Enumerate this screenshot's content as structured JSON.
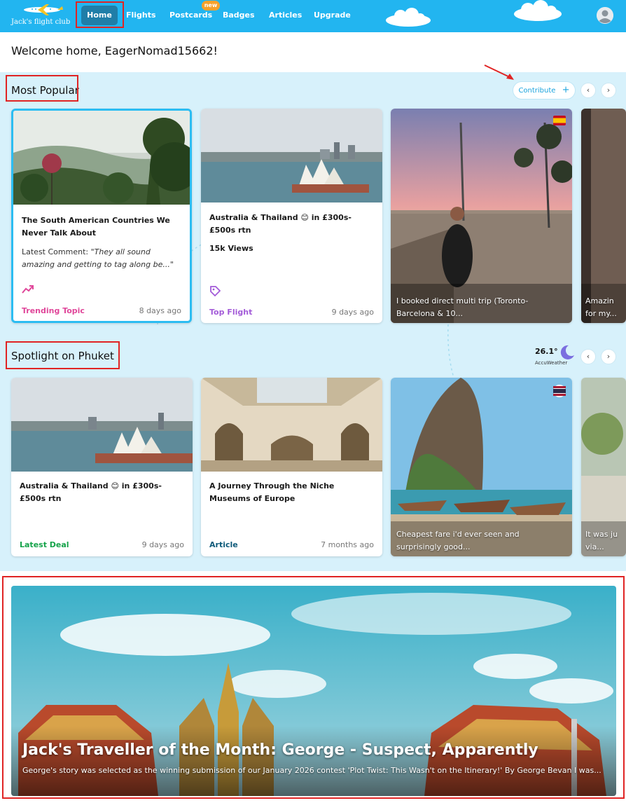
{
  "header": {
    "logo_text": "Jack's flight club",
    "nav": {
      "home": "Home",
      "flights": "Flights",
      "postcards": "Postcards",
      "postcards_badge": "new",
      "badges": "Badges",
      "articles": "Articles",
      "upgrade": "Upgrade"
    },
    "accent_color": "#22b5f0"
  },
  "welcome": "Welcome home, EagerNomad15662!",
  "most_popular": {
    "title": "Most Popular",
    "contribute_label": "Contribute",
    "contribute_icon": "+",
    "prev_icon": "‹",
    "next_icon": "›",
    "cards": [
      {
        "title": "The South American Countries We Never Talk About",
        "comment_prefix": "Latest Comment: ",
        "comment": "\"They all sound amazing and getting to tag along be...\"",
        "tag": "Trending Topic",
        "tag_icon": "trending-up-icon",
        "time": "8 days ago"
      },
      {
        "title": "Australia & Thailand 😊 in £300s-£500s rtn",
        "views": "15k Views",
        "tag": "Top Flight",
        "tag_icon": "price-tag-icon",
        "time": "9 days ago"
      },
      {
        "overlay": "I booked direct multi trip (Toronto-Barcelona & 10..."
      },
      {
        "overlay": "Amazin for my..."
      }
    ]
  },
  "spotlight": {
    "title": "Spotlight on Phuket",
    "weather_temp": "26.1°",
    "weather_brand": "AccuWeather",
    "prev_icon": "‹",
    "next_icon": "›",
    "cards": [
      {
        "title": "Australia & Thailand 😊 in £300s-£500s rtn",
        "tag": "Latest Deal",
        "time": "9 days ago"
      },
      {
        "title": "A Journey Through the Niche Museums of Europe",
        "tag": "Article",
        "time": "7 months ago"
      },
      {
        "overlay": "Cheapest fare i'd ever seen and surprisingly good..."
      },
      {
        "overlay": "It was ju via..."
      }
    ]
  },
  "banner": {
    "title": "Jack's Traveller of the Month: George - Suspect, Apparently",
    "text": "George's story was selected as the winning submission of our January 2026 contest 'Plot Twist: This Wasn't on the Itinerary!' By George Bevan I was..."
  },
  "colors": {
    "trending": "#e0479a",
    "top_flight": "#a35bd8",
    "latest_deal": "#16a34a",
    "article": "#0f5b7a"
  }
}
